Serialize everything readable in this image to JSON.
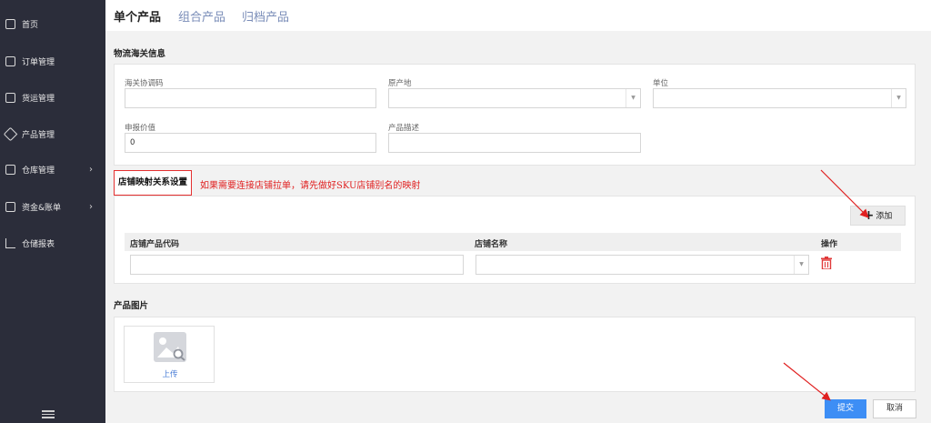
{
  "sidebar": {
    "items": [
      {
        "label": "首页",
        "icon": "home-icon"
      },
      {
        "label": "订单管理",
        "icon": "order-icon"
      },
      {
        "label": "货运管理",
        "icon": "truck-icon"
      },
      {
        "label": "产品管理",
        "icon": "tag-icon"
      },
      {
        "label": "仓库管理",
        "icon": "warehouse-icon",
        "chevron": "›"
      },
      {
        "label": "资金&账单",
        "icon": "wallet-icon",
        "chevron": "›"
      },
      {
        "label": "仓储报表",
        "icon": "chart-icon"
      }
    ],
    "collapse_icon": "menu-collapse-icon"
  },
  "tabs": [
    "单个产品",
    "组合产品",
    "归档产品"
  ],
  "customs": {
    "title": "物流海关信息",
    "hs_code_label": "海关协调码",
    "origin_label": "原产地",
    "unit_label": "单位",
    "declared_value_label": "申报价值",
    "declared_value": "0",
    "description_label": "产品描述"
  },
  "mapping": {
    "title": "店铺映射关系设置",
    "note": "如果需要连接店铺拉单，请先做好SKU店铺别名的映射",
    "add_label": "添加",
    "add_icon": "+",
    "col_code": "店铺产品代码",
    "col_store": "店铺名称",
    "col_action": "操作"
  },
  "images": {
    "title": "产品图片",
    "upload_label": "上传"
  },
  "footer": {
    "submit_label": "提交",
    "cancel_label": "取消"
  },
  "colors": {
    "sidebar_bg": "#2b2d3a",
    "primary": "#3d8ef5",
    "annotation_red": "#e02020",
    "delete_red": "#e03a3a"
  }
}
